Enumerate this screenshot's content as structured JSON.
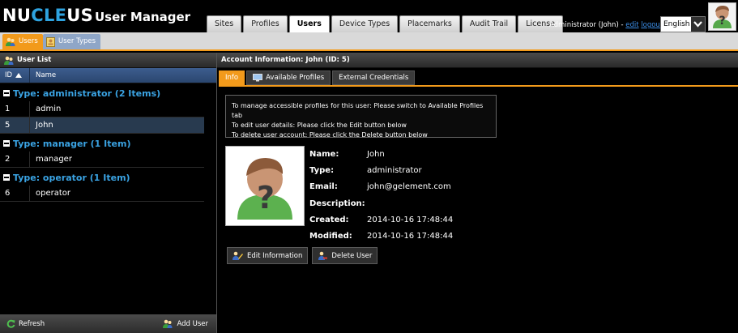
{
  "header": {
    "logo_prefix": "NU",
    "logo_highlight": "CLE",
    "logo_suffix": "US",
    "app_title": "User Manager",
    "tabs": [
      "Sites",
      "Profiles",
      "Users",
      "Device Types",
      "Placemarks",
      "Audit Trail",
      "License"
    ],
    "active_tab": "Users",
    "user_label": "Administrator (John) - ",
    "edit_link": "edit",
    "logout_link": "logout",
    "language": "English"
  },
  "subtabs": [
    "Users",
    "User Types"
  ],
  "left": {
    "title": "User List",
    "col_id": "ID",
    "col_name": "Name",
    "groups": [
      {
        "label": "Type: administrator (2 Items)",
        "rows": [
          {
            "id": "1",
            "name": "admin"
          },
          {
            "id": "5",
            "name": "John"
          }
        ]
      },
      {
        "label": "Type: manager (1 Item)",
        "rows": [
          {
            "id": "2",
            "name": "manager"
          }
        ]
      },
      {
        "label": "Type: operator (1 Item)",
        "rows": [
          {
            "id": "6",
            "name": "operator"
          }
        ]
      }
    ],
    "refresh": "Refresh",
    "add_user": "Add User"
  },
  "right": {
    "title": "Account Information: John (ID: 5)",
    "tabs": [
      "Info",
      "Available Profiles",
      "External Credentials"
    ],
    "notice": [
      "To manage accessible profiles for this user: Please switch to Available Profiles tab",
      "To edit user details: Please click the Edit button below",
      "To delete user account: Please click the Delete button below"
    ],
    "labels": {
      "name": "Name:",
      "type": "Type:",
      "email": "Email:",
      "description": "Description:",
      "created": "Created:",
      "modified": "Modified:"
    },
    "values": {
      "name": "John",
      "type": "administrator",
      "email": "john@gelement.com",
      "description": "",
      "created": "2014-10-16 17:48:44",
      "modified": "2014-10-16 17:48:44"
    },
    "edit_button": "Edit Information",
    "delete_button": "Delete User"
  },
  "colors": {
    "accent": "#f29a1b",
    "link": "#3aa3e3",
    "selected_row": "#283a4f"
  }
}
